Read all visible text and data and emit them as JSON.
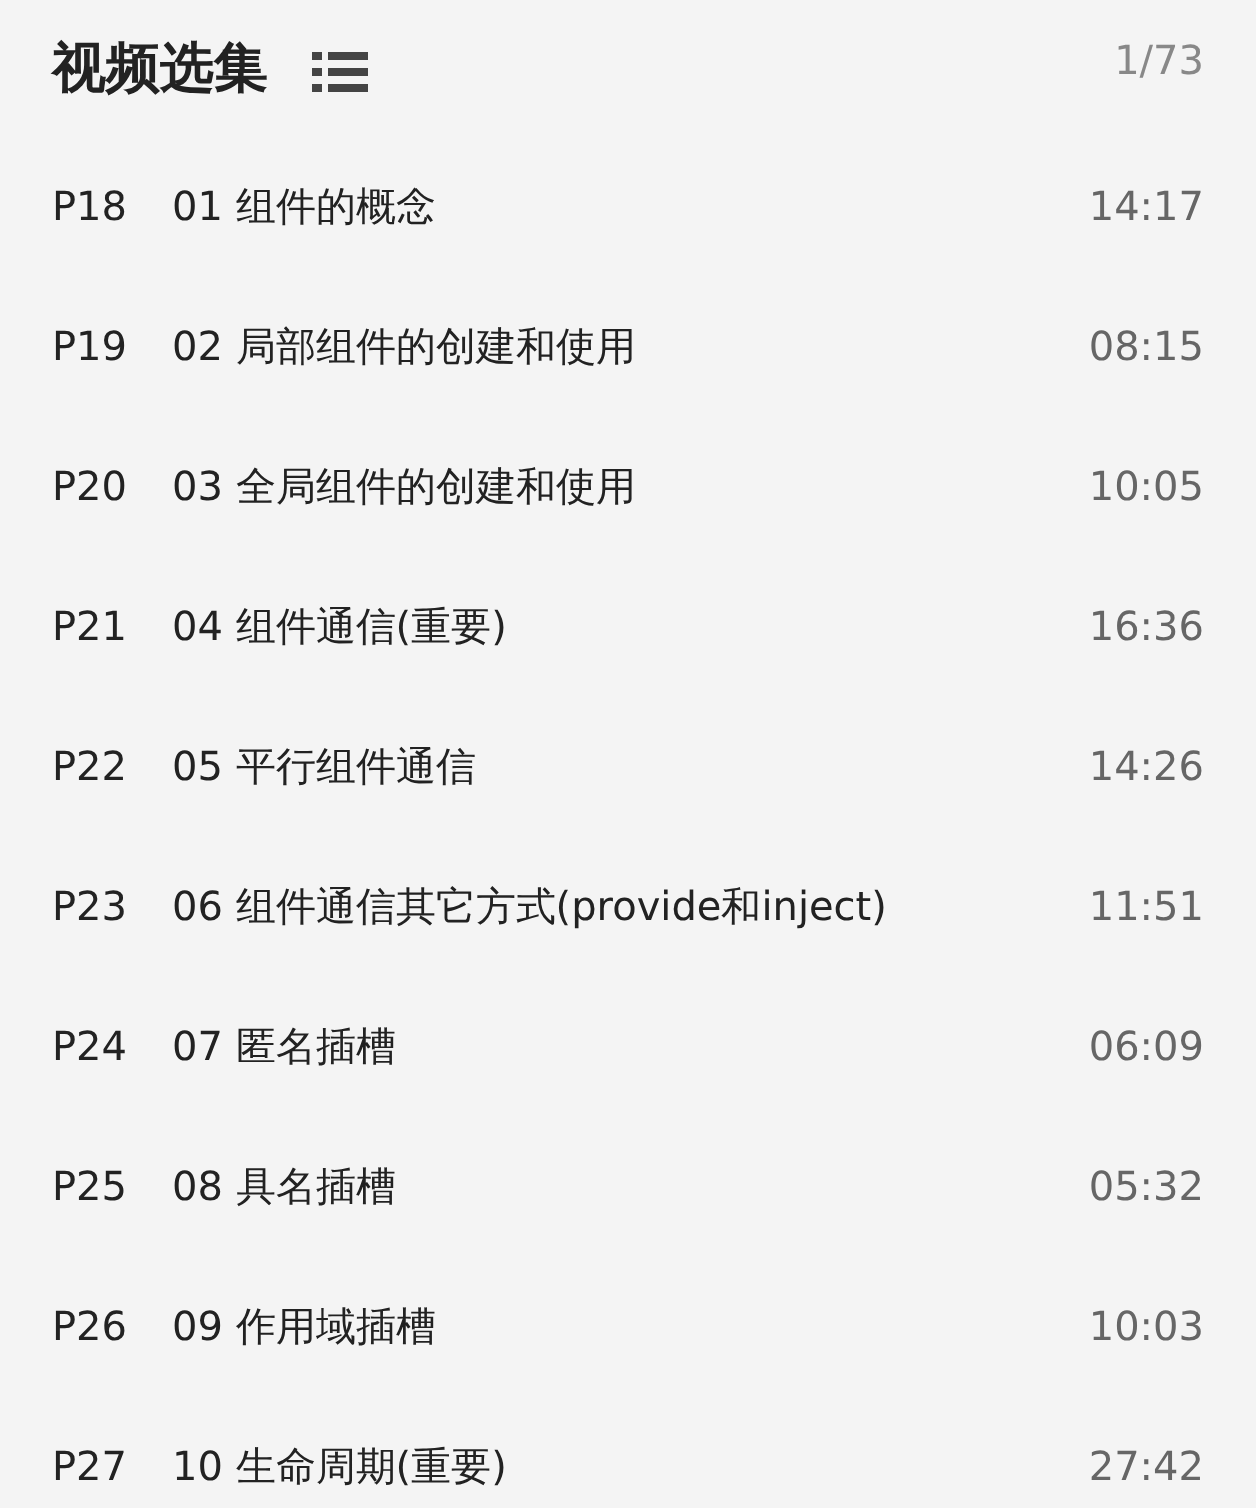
{
  "header": {
    "title": "视频选集",
    "count": "1/73"
  },
  "episodes": [
    {
      "part": "P18",
      "title": "01 组件的概念",
      "duration": "14:17"
    },
    {
      "part": "P19",
      "title": "02 局部组件的创建和使用",
      "duration": "08:15"
    },
    {
      "part": "P20",
      "title": "03 全局组件的创建和使用",
      "duration": "10:05"
    },
    {
      "part": "P21",
      "title": "04 组件通信(重要)",
      "duration": "16:36"
    },
    {
      "part": "P22",
      "title": "05 平行组件通信",
      "duration": "14:26"
    },
    {
      "part": "P23",
      "title": "06 组件通信其它方式(provide和inject)",
      "duration": "11:51"
    },
    {
      "part": "P24",
      "title": "07 匿名插槽",
      "duration": "06:09"
    },
    {
      "part": "P25",
      "title": "08 具名插槽",
      "duration": "05:32"
    },
    {
      "part": "P26",
      "title": "09 作用域插槽",
      "duration": "10:03"
    },
    {
      "part": "P27",
      "title": "10 生命周期(重要)",
      "duration": "27:42"
    }
  ]
}
